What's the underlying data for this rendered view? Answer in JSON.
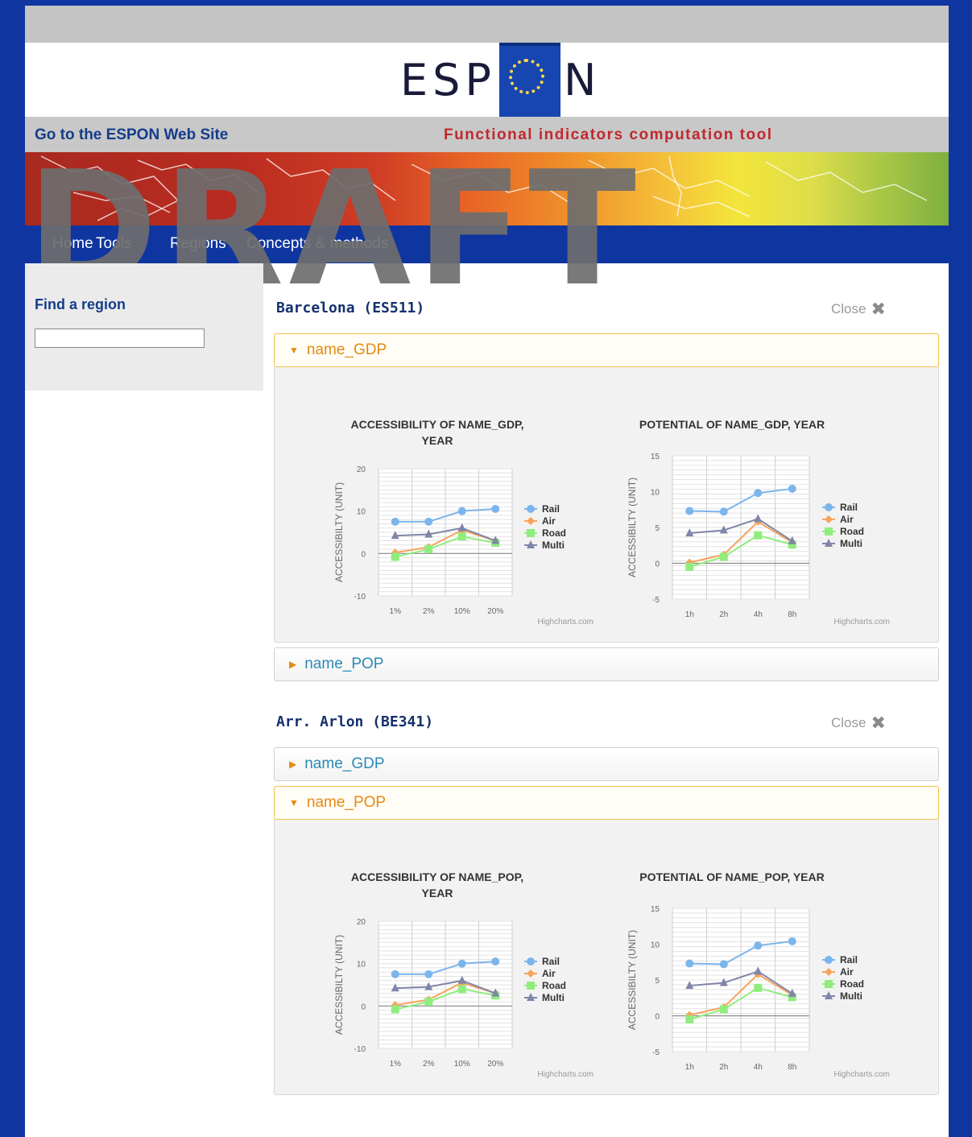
{
  "header": {
    "logo_text_left": "ESP",
    "logo_text_right": "N",
    "site_link": "Go to the ESPON Web Site",
    "tool_title": "Functional indicators computation tool"
  },
  "watermark": "DRAFT",
  "nav": {
    "items": [
      "Home",
      "Tools",
      "Regions",
      "Concepts & methods"
    ]
  },
  "sidebar": {
    "find_label": "Find a region",
    "search_value": ""
  },
  "regions": [
    {
      "title": "Barcelona (ES511)",
      "close_label": "Close",
      "panels": [
        {
          "label": "name_GDP",
          "state": "open"
        },
        {
          "label": "name_POP",
          "state": "closed"
        }
      ]
    },
    {
      "title": "Arr. Arlon (BE341)",
      "close_label": "Close",
      "panels": [
        {
          "label": "name_GDP",
          "state": "closed"
        },
        {
          "label": "name_POP",
          "state": "open"
        }
      ]
    }
  ],
  "colors": {
    "rail": "#7cb5ec",
    "air": "#f7a35c",
    "road": "#90ed7d",
    "multi": "#8085a9",
    "header_blue": "#153d8a",
    "title_red": "#c0282d",
    "frame_blue": "#0f35a0"
  },
  "credits": "Highcharts.com",
  "chart_data": [
    {
      "type": "line",
      "title": "ACCESSIBILITY OF NAME_GDP, YEAR",
      "ylabel": "ACCESSIBILTY (UNIT)",
      "categories": [
        "1%",
        "2%",
        "10%",
        "20%"
      ],
      "yticks": [
        -10,
        0,
        10,
        20
      ],
      "ylim": [
        -10,
        20
      ],
      "series": [
        {
          "name": "Rail",
          "values": [
            7.5,
            7.5,
            10,
            10.5
          ]
        },
        {
          "name": "Air",
          "values": [
            0.2,
            1.5,
            5.5,
            3
          ]
        },
        {
          "name": "Road",
          "values": [
            -0.8,
            1,
            4,
            2.5
          ]
        },
        {
          "name": "Multi",
          "values": [
            4.2,
            4.5,
            6,
            3
          ]
        }
      ]
    },
    {
      "type": "line",
      "title": "POTENTIAL OF NAME_GDP, YEAR",
      "ylabel": "ACCESSIBILTY (UNIT)",
      "categories": [
        "1h",
        "2h",
        "4h",
        "8h"
      ],
      "yticks": [
        -5,
        0,
        5,
        10,
        15
      ],
      "ylim": [
        -5,
        15
      ],
      "series": [
        {
          "name": "Rail",
          "values": [
            7.3,
            7.2,
            9.8,
            10.4
          ]
        },
        {
          "name": "Air",
          "values": [
            0.1,
            1.2,
            5.8,
            2.9
          ]
        },
        {
          "name": "Road",
          "values": [
            -0.5,
            0.9,
            3.9,
            2.6
          ]
        },
        {
          "name": "Multi",
          "values": [
            4.2,
            4.6,
            6.2,
            3.1
          ]
        }
      ]
    },
    {
      "type": "line",
      "title": "ACCESSIBILITY OF NAME_POP, YEAR",
      "ylabel": "ACCESSIBILTY (UNIT)",
      "categories": [
        "1%",
        "2%",
        "10%",
        "20%"
      ],
      "yticks": [
        -10,
        0,
        10,
        20
      ],
      "ylim": [
        -10,
        20
      ],
      "series": [
        {
          "name": "Rail",
          "values": [
            7.5,
            7.5,
            10,
            10.5
          ]
        },
        {
          "name": "Air",
          "values": [
            0.2,
            1.5,
            5.5,
            3
          ]
        },
        {
          "name": "Road",
          "values": [
            -0.8,
            1,
            4,
            2.5
          ]
        },
        {
          "name": "Multi",
          "values": [
            4.2,
            4.5,
            6,
            3
          ]
        }
      ]
    },
    {
      "type": "line",
      "title": "POTENTIAL OF NAME_POP, YEAR",
      "ylabel": "ACCESSIBILTY (UNIT)",
      "categories": [
        "1h",
        "2h",
        "4h",
        "8h"
      ],
      "yticks": [
        -5,
        0,
        5,
        10,
        15
      ],
      "ylim": [
        -5,
        15
      ],
      "series": [
        {
          "name": "Rail",
          "values": [
            7.3,
            7.2,
            9.8,
            10.4
          ]
        },
        {
          "name": "Air",
          "values": [
            0.1,
            1.2,
            5.8,
            2.9
          ]
        },
        {
          "name": "Road",
          "values": [
            -0.5,
            0.9,
            3.9,
            2.6
          ]
        },
        {
          "name": "Multi",
          "values": [
            4.2,
            4.6,
            6.2,
            3.1
          ]
        }
      ]
    }
  ]
}
